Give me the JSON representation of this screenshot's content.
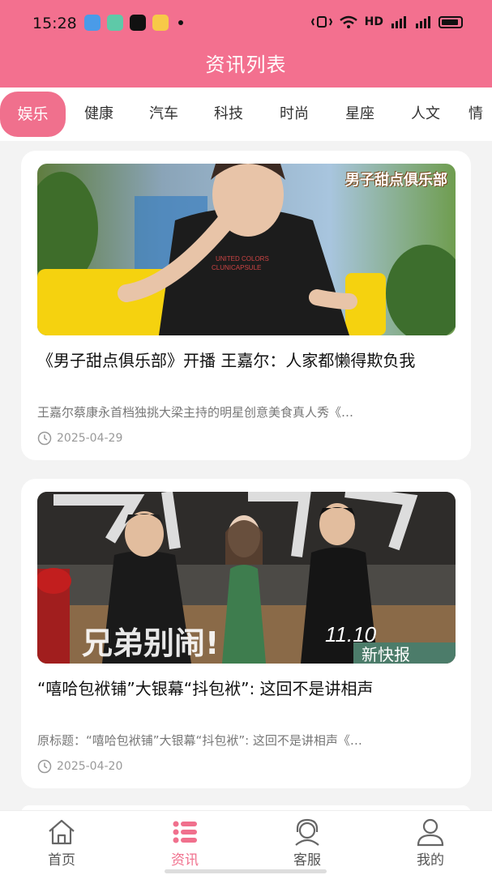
{
  "status_bar": {
    "time": "15:28",
    "network": "HD"
  },
  "header": {
    "title": "资讯列表"
  },
  "colors": {
    "accent": "#f0708d",
    "header_bg": "#f3708f"
  },
  "tabs": [
    {
      "label": "娱乐",
      "active": true
    },
    {
      "label": "健康"
    },
    {
      "label": "汽车"
    },
    {
      "label": "科技"
    },
    {
      "label": "时尚"
    },
    {
      "label": "星座"
    },
    {
      "label": "人文"
    },
    {
      "label": "情"
    }
  ],
  "articles": [
    {
      "title": "《男子甜点俱乐部》开播 王嘉尔：人家都懒得欺负我",
      "summary": "王嘉尔蔡康永首档独挑大梁主持的明星创意美食真人秀《…",
      "date": "2025-04-29",
      "image_caption": "男子甜点俱乐部"
    },
    {
      "title": "“嘻哈包袱铺”大银幕“抖包袱”: 这回不是讲相声",
      "summary": "原标题：“嘻哈包袱铺”大银幕“抖包袱”: 这回不是讲相声《…",
      "date": "2025-04-20",
      "image_caption": "兄弟别闹！",
      "image_date": "11.10",
      "image_badge": "新快报"
    }
  ],
  "bottom_nav": [
    {
      "label": "首页",
      "icon": "home-icon"
    },
    {
      "label": "资讯",
      "icon": "list-icon",
      "active": true
    },
    {
      "label": "客服",
      "icon": "headset-icon"
    },
    {
      "label": "我的",
      "icon": "user-icon"
    }
  ]
}
